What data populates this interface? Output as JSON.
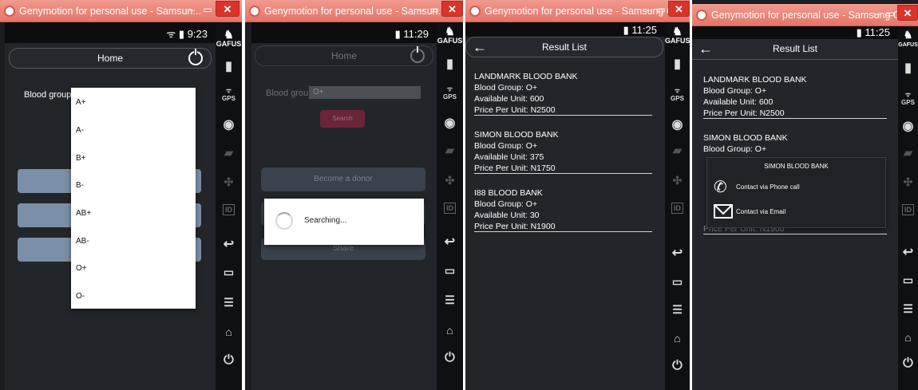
{
  "windows": [
    {
      "title": "Genymotion for personal use - Samsun..."
    },
    {
      "title": "Genymotion for personal use - Samsun..."
    },
    {
      "title": "Genymotion for personal use - Samsung Ga..."
    },
    {
      "title": "Genymotion for personal use - Samsung Ga..."
    }
  ],
  "window_controls": {
    "minimize": "–",
    "restore": "▭",
    "close": "✕"
  },
  "status": {
    "w1_time": "9:23",
    "w2_time": "11:29",
    "w3_time": "11:25",
    "w4_time": "11:25",
    "battery": "▮"
  },
  "sidebar": {
    "genymotion_label": "GAFUS",
    "gps_label": "GPS",
    "id_label": "ID"
  },
  "screen1": {
    "toolbar_title": "Home",
    "blood_group_label": "Blood group :",
    "options": [
      "A+",
      "A-",
      "B+",
      "B-",
      "AB+",
      "AB-",
      "O+",
      "O-"
    ]
  },
  "screen2": {
    "toolbar_title": "Home",
    "blood_group_label": "Blood group :",
    "blood_group_value": "O+",
    "search_label": "Search",
    "become_donor_label": "Become a donor",
    "share_label": "Share",
    "searching_text": "Searching..."
  },
  "screen3": {
    "toolbar_title": "Result List",
    "results": [
      {
        "name": "LANDMARK BLOOD BANK",
        "group": "Blood Group: O+",
        "units": "Available Unit: 600",
        "price": "Price Per Unit: N2500"
      },
      {
        "name": "SIMON BLOOD BANK",
        "group": "Blood Group: O+",
        "units": "Available Unit: 375",
        "price": "Price Per Unit: N1750"
      },
      {
        "name": "I88 BLOOD BANK",
        "group": "Blood Group: O+",
        "units": "Available Unit: 30",
        "price": "Price Per Unit: N1900"
      }
    ]
  },
  "screen4": {
    "toolbar_title": "Result List",
    "results": [
      {
        "name": "LANDMARK BLOOD BANK",
        "group": "Blood Group: O+",
        "units": "Available Unit: 600",
        "price": "Price Per Unit: N2500"
      },
      {
        "name": "SIMON BLOOD BANK",
        "group": "Blood Group: O+"
      }
    ],
    "partial_price": "Price Per Unit: N1900",
    "context_menu": {
      "title": "SIMON BLOOD BANK",
      "phone_label": "Contact via Phone call",
      "email_label": "Contact via Email"
    }
  },
  "colors": {
    "titlebar": "#e5746a",
    "close": "#d9342b",
    "search_button": "#8a2442",
    "dropdown_buttons": "#7b8fa8"
  }
}
